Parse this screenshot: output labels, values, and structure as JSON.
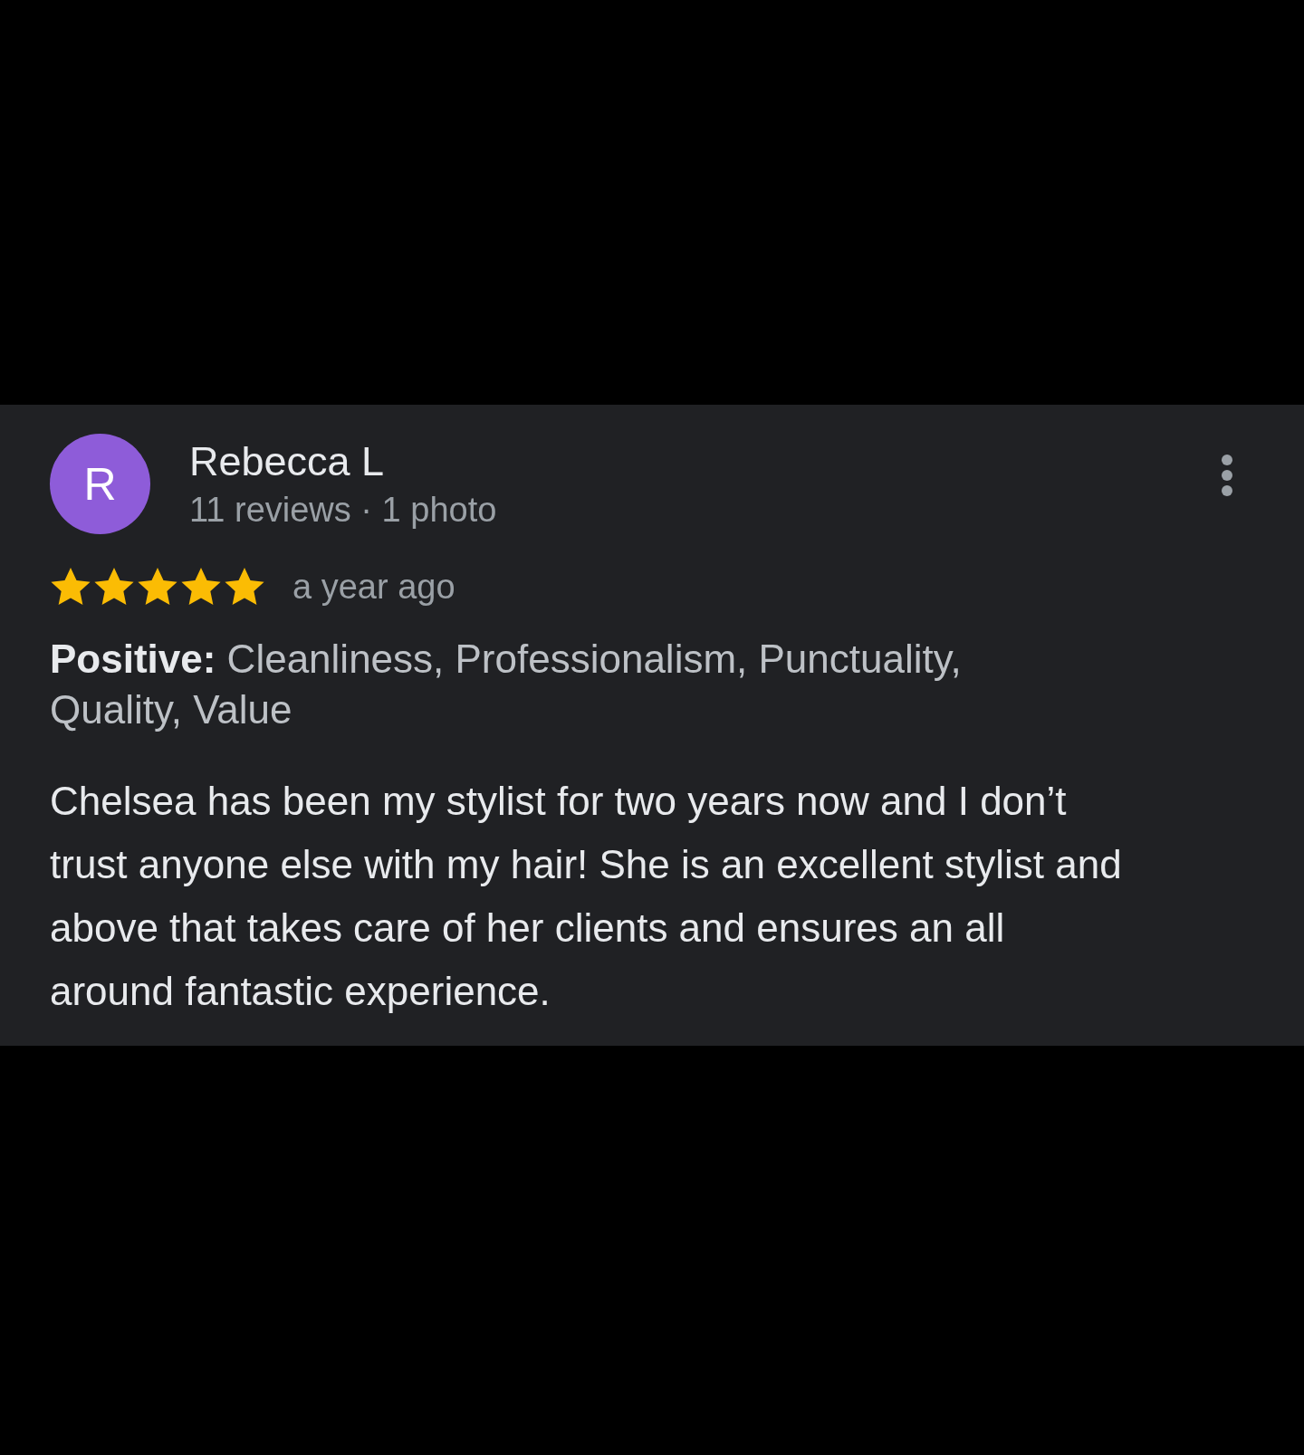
{
  "review": {
    "avatar_letter": "R",
    "author": "Rebecca L",
    "author_meta": "11 reviews · 1 photo",
    "stars": 5,
    "time": "a year ago",
    "highlights": "**Positive:** Cleanliness, Professionalism, Punctuality, Quality, Value",
    "text": "Chelsea has been my stylist for two years now and I don’t trust anyone else with my hair! She is an excellent stylist and above that takes care of her clients and ensures an all around fantastic experience."
  }
}
